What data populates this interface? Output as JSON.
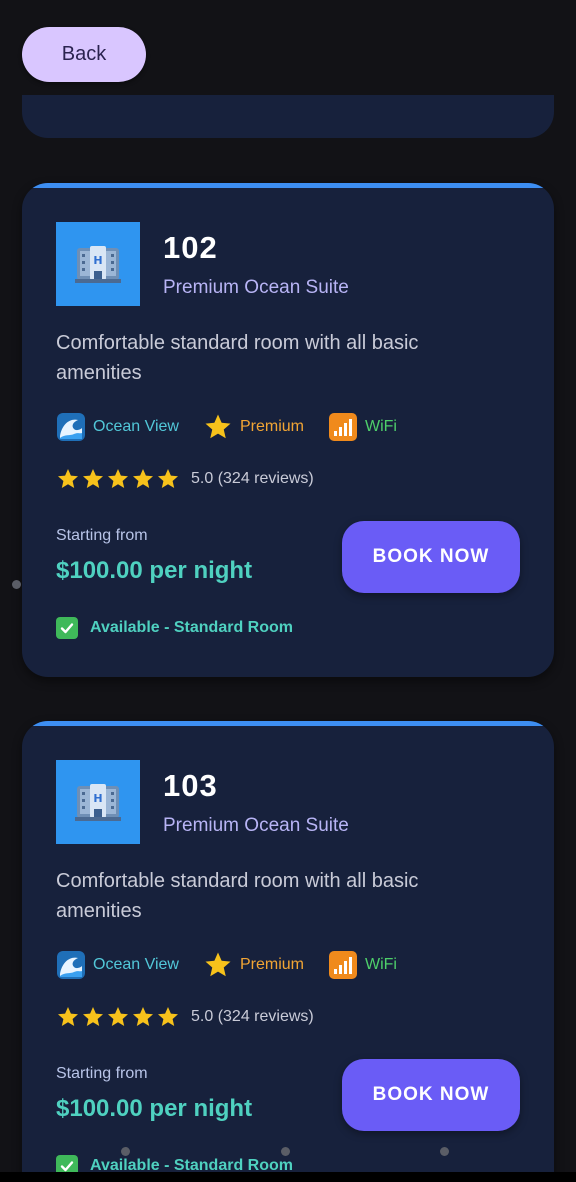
{
  "header": {
    "back_label": "Back"
  },
  "rooms": [
    {
      "number": "102",
      "type": "Premium Ocean Suite",
      "description": "Comfortable standard room with all basic amenities",
      "features": [
        {
          "icon": "wave-icon",
          "label": "Ocean View",
          "color": "#52c7d8"
        },
        {
          "icon": "star-icon",
          "label": "Premium",
          "color": "#f2a534"
        },
        {
          "icon": "signal-icon",
          "label": "WiFi",
          "color": "#4ecf6a"
        }
      ],
      "stars": 5,
      "rating_text": "5.0 (324 reviews)",
      "price_label": "Starting from",
      "price": "$100.00 per night",
      "book_label": "BOOK NOW",
      "availability": "Available - Standard Room"
    },
    {
      "number": "103",
      "type": "Premium Ocean Suite",
      "description": "Comfortable standard room with all basic amenities",
      "features": [
        {
          "icon": "wave-icon",
          "label": "Ocean View",
          "color": "#52c7d8"
        },
        {
          "icon": "star-icon",
          "label": "Premium",
          "color": "#f2a534"
        },
        {
          "icon": "signal-icon",
          "label": "WiFi",
          "color": "#4ecf6a"
        }
      ],
      "stars": 5,
      "rating_text": "5.0 (324 reviews)",
      "price_label": "Starting from",
      "price": "$100.00 per night",
      "book_label": "BOOK NOW",
      "availability": "Available - Standard Room"
    }
  ],
  "colors": {
    "background": "#121216",
    "card": "#17213c",
    "accent_bar": "#3d8ef2",
    "book_button": "#6a5cf6",
    "price": "#4fd1c0",
    "back_button": "#d9c6ff"
  }
}
